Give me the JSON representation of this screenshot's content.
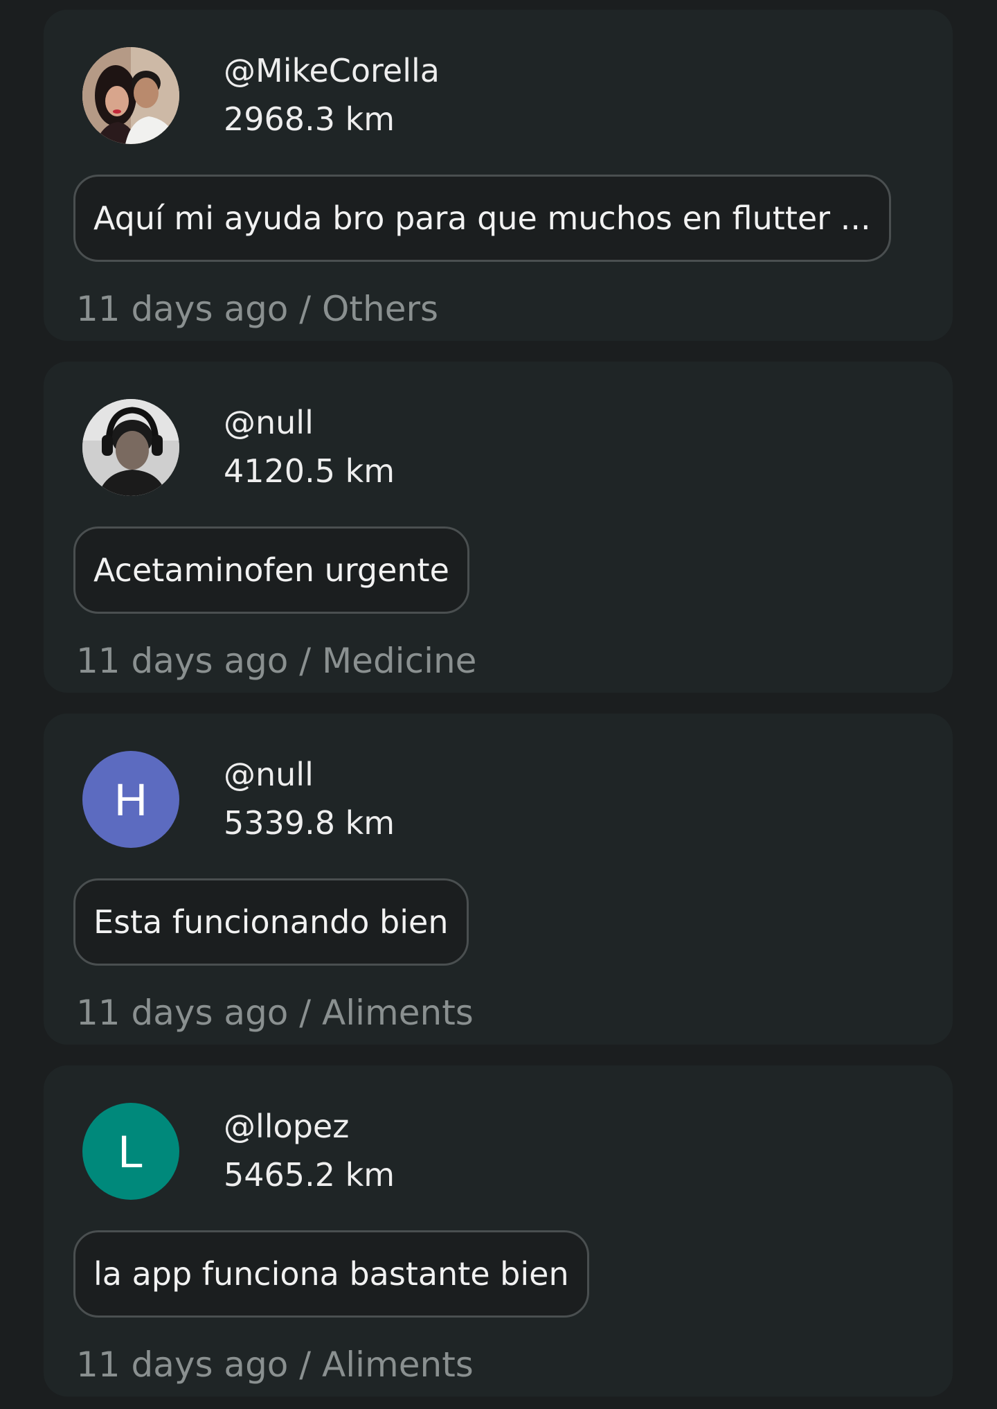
{
  "posts": [
    {
      "avatar": {
        "type": "photo",
        "icon": "couple-photo-avatar"
      },
      "username": "@MikeCorella",
      "distance": "2968.3 km",
      "message": "Aquí mi ayuda bro para que muchos en flutter ...",
      "time_ago": "11 days ago",
      "separator": " / ",
      "category": "Others"
    },
    {
      "avatar": {
        "type": "photo",
        "icon": "headphones-man-photo-avatar"
      },
      "username": "@null",
      "distance": "4120.5 km",
      "message": "Acetaminofen urgente",
      "time_ago": "11 days ago",
      "separator": " / ",
      "category": "Medicine"
    },
    {
      "avatar": {
        "type": "letter",
        "letter": "H",
        "color": "#5c6bc0"
      },
      "username": "@null",
      "distance": "5339.8 km",
      "message": "Esta funcionando bien",
      "time_ago": "11 days ago",
      "separator": " / ",
      "category": "Aliments"
    },
    {
      "avatar": {
        "type": "letter",
        "letter": "L",
        "color": "#00897b"
      },
      "username": "@llopez",
      "distance": "5465.2 km",
      "message": "la app funciona bastante bien",
      "time_ago": "11 days ago",
      "separator": " / ",
      "category": "Aliments"
    }
  ],
  "colors": {
    "background": "#1b1e1f",
    "card": "#1f2526",
    "text": "#eeeeee",
    "meta_text": "#8a9090",
    "bubble_border": "#4a4f50"
  }
}
